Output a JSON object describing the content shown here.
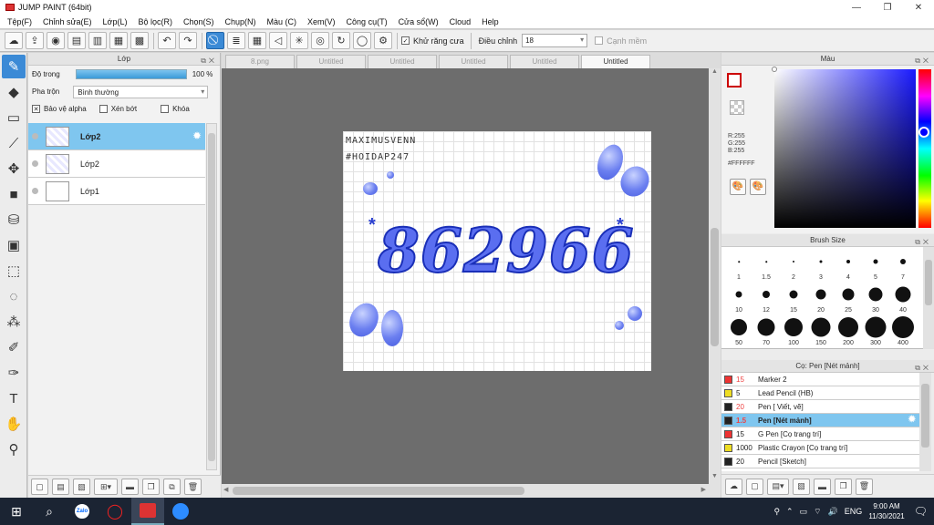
{
  "window": {
    "title": "JUMP PAINT (64bit)"
  },
  "menu": [
    "Tệp(F)",
    "Chỉnh sửa(E)",
    "Lớp(L)",
    "Bộ lọc(R)",
    "Chọn(S)",
    "Chụp(N)",
    "Màu (C)",
    "Xem(V)",
    "Công cụ(T)",
    "Cửa sổ(W)",
    "Cloud",
    "Help"
  ],
  "toolbar": {
    "antialias_label": "Khử răng cưa",
    "adjust_label": "Điều chỉnh",
    "adjust_value": "18",
    "edge_label": "Cạnh mềm"
  },
  "layer_panel": {
    "title": "Lớp",
    "opacity_label": "Độ trong",
    "opacity_value": "100 %",
    "opacity": 1.0,
    "blend_label": "Pha trộn",
    "blend_value": "Bình thường",
    "protect_alpha": "Bảo vệ alpha",
    "clip": "Xén bớt",
    "lock": "Khóa",
    "layers": [
      {
        "name": "Lớp2",
        "selected": true
      },
      {
        "name": "Lớp2",
        "selected": false
      },
      {
        "name": "Lớp1",
        "selected": false
      }
    ]
  },
  "tabs": [
    {
      "label": "8.png",
      "active": false
    },
    {
      "label": "Untitled",
      "active": false
    },
    {
      "label": "Untitled",
      "active": false
    },
    {
      "label": "Untitled",
      "active": false
    },
    {
      "label": "Untitled",
      "active": false
    },
    {
      "label": "Untitled",
      "active": true
    }
  ],
  "artwork": {
    "watermark1": "MAXIMUSVENN",
    "watermark2": "#HOIDAP247",
    "number": "862966"
  },
  "color_panel": {
    "title": "Màu",
    "r": "R:255",
    "g": "G:255",
    "b": "B:255",
    "hex": "#FFFFFF",
    "fg": "#ffffff"
  },
  "brush_size": {
    "title": "Brush Size",
    "sizes": [
      "1",
      "1.5",
      "2",
      "3",
      "4",
      "5",
      "7",
      "10",
      "12",
      "15",
      "20",
      "25",
      "30",
      "40",
      "50",
      "70",
      "100",
      "150",
      "200",
      "300",
      "400"
    ]
  },
  "subtool": {
    "title": "Cọ: Pen [Nét mảnh]",
    "items": [
      {
        "size": "15",
        "name": "Marker 2",
        "color": "#ee3333",
        "red": true,
        "selected": false
      },
      {
        "size": "5",
        "name": "Lead Pencil (HB)",
        "color": "#eedd22",
        "red": false,
        "selected": false
      },
      {
        "size": "20",
        "name": "Pen [ Viết, vẽ]",
        "color": "#222222",
        "red": true,
        "selected": false
      },
      {
        "size": "1.5",
        "name": "Pen [Nét mảnh]",
        "color": "#222222",
        "red": true,
        "selected": true
      },
      {
        "size": "15",
        "name": "G Pen [Cọ trang trí]",
        "color": "#ee3333",
        "red": false,
        "selected": false
      },
      {
        "size": "1000",
        "name": "Plastic Crayon [Cọ trang trí]",
        "color": "#eedd22",
        "red": false,
        "selected": false
      },
      {
        "size": "20",
        "name": "Pencil [Sketch]",
        "color": "#222222",
        "red": false,
        "selected": false
      }
    ]
  },
  "taskbar": {
    "lang": "ENG",
    "time": "9:00 AM",
    "date": "11/30/2021",
    "zalo": "Zalo"
  }
}
